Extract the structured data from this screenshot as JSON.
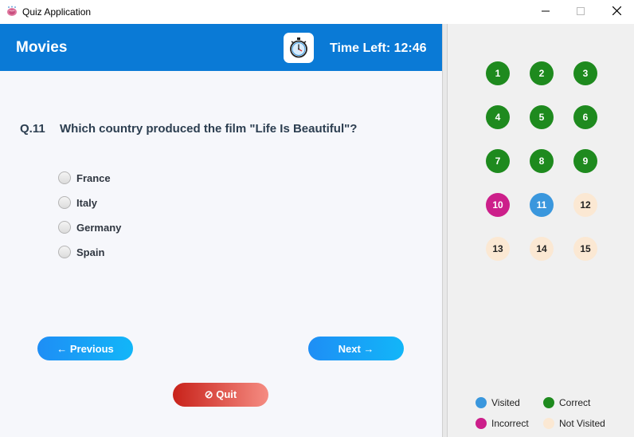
{
  "window": {
    "title": "Quiz Application",
    "icon": "brain-icon",
    "controls": [
      "minimize-icon",
      "maximize-icon",
      "close-icon"
    ]
  },
  "header": {
    "category": "Movies",
    "timer_icon": "stopwatch-icon",
    "time_left": "Time Left: 12:46",
    "background_color": "#0a7ad6"
  },
  "question": {
    "number": "Q.11",
    "text": "Which country produced the film \"Life Is Beautiful\"?",
    "options": [
      "France",
      "Italy",
      "Germany",
      "Spain"
    ],
    "selected": null
  },
  "buttons": {
    "previous": "← Previous",
    "next": "Next →",
    "quit": "⊘ Quit"
  },
  "navigator": {
    "questions": [
      {
        "label": "1",
        "status": "correct"
      },
      {
        "label": "2",
        "status": "correct"
      },
      {
        "label": "3",
        "status": "correct"
      },
      {
        "label": "4",
        "status": "correct"
      },
      {
        "label": "5",
        "status": "correct"
      },
      {
        "label": "6",
        "status": "correct"
      },
      {
        "label": "7",
        "status": "correct"
      },
      {
        "label": "8",
        "status": "correct"
      },
      {
        "label": "9",
        "status": "correct"
      },
      {
        "label": "10",
        "status": "incorrect"
      },
      {
        "label": "11",
        "status": "visited"
      },
      {
        "label": "12",
        "status": "not_visited"
      },
      {
        "label": "13",
        "status": "not_visited"
      },
      {
        "label": "14",
        "status": "not_visited"
      },
      {
        "label": "15",
        "status": "not_visited"
      }
    ]
  },
  "legend": {
    "visited": "Visited",
    "correct": "Correct",
    "incorrect": "Incorrect",
    "not_visited": "Not Visited"
  },
  "colors": {
    "visited": "#3a97dd",
    "correct": "#1e8a1e",
    "incorrect": "#cc1f8a",
    "not_visited": "#fbe8d3"
  }
}
